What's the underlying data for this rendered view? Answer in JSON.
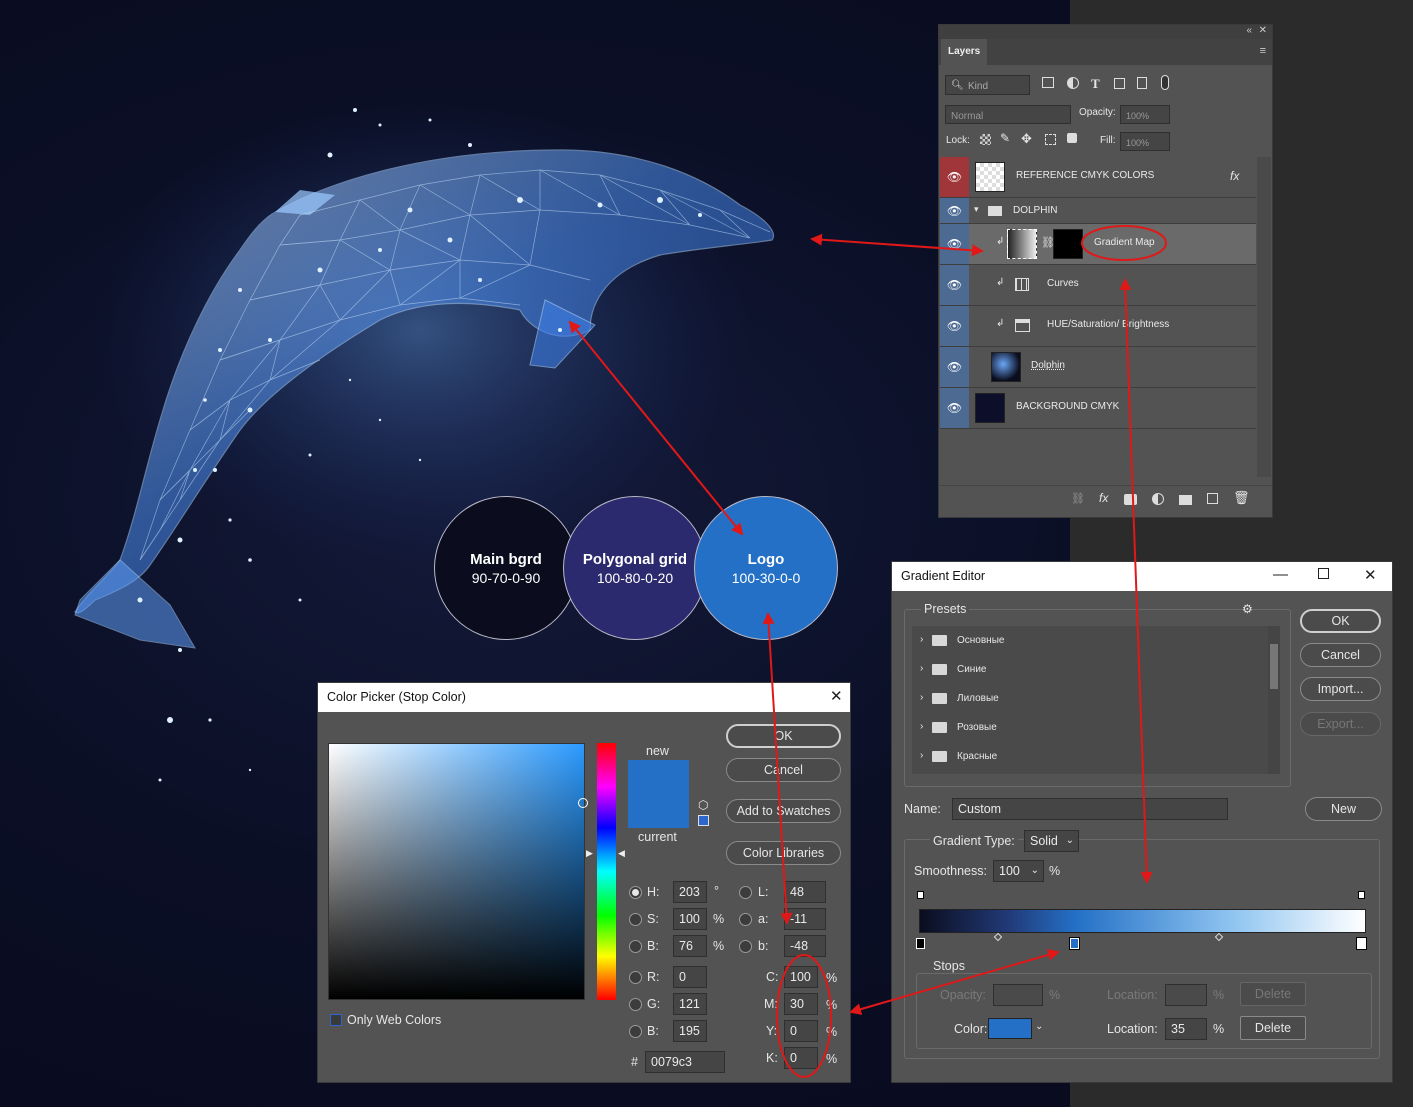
{
  "colors": {
    "arrow": "#e01818",
    "main_bgrd_fill": "#0b0d1e",
    "poly_grid_fill": "#2b2a6e",
    "logo_fill": "#2470c6",
    "eye_blue": "#4d6a92",
    "eye_red": "#a0363a"
  },
  "circles": [
    {
      "title": "Main bgrd",
      "value": "90-70-0-90"
    },
    {
      "title": "Polygonal grid",
      "value": "100-80-0-20"
    },
    {
      "title": "Logo",
      "value": "100-30-0-0"
    }
  ],
  "layers_panel": {
    "tab": "Layers",
    "filter_kind": "Kind",
    "blend_mode": "Normal",
    "opacity_label": "Opacity:",
    "opacity_value": "100%",
    "lock_label": "Lock:",
    "fill_label": "Fill:",
    "fill_value": "100%",
    "fx_label": "fx",
    "layers": [
      "REFERENCE CMYK COLORS",
      "DOLPHIN",
      "Gradient Map",
      "Curves",
      "HUE/Saturation/ Brightness",
      "Dolphin",
      "BACKGROUND CMYK"
    ]
  },
  "gradient_editor": {
    "title": "Gradient Editor",
    "presets_label": "Presets",
    "presets": [
      "Основные",
      "Синие",
      "Лиловые",
      "Розовые",
      "Красные"
    ],
    "ok": "OK",
    "cancel": "Cancel",
    "import": "Import...",
    "export": "Export...",
    "name_label": "Name:",
    "name_value": "Custom",
    "new": "New",
    "gradient_type_label": "Gradient Type:",
    "gradient_type_value": "Solid",
    "smoothness_label": "Smoothness:",
    "smoothness_value": "100",
    "percent": "%",
    "stops_label": "Stops",
    "opacity_label": "Opacity:",
    "location_label": "Location:",
    "delete": "Delete",
    "color_label": "Color:",
    "color_location_value": "35",
    "stop_color": "#2470c6"
  },
  "color_picker": {
    "title": "Color Picker (Stop Color)",
    "new_label": "new",
    "current_label": "current",
    "ok": "OK",
    "cancel": "Cancel",
    "add_to_swatches": "Add to Swatches",
    "color_libraries": "Color Libraries",
    "only_web_colors": "Only Web Colors",
    "hsb": {
      "H": "203",
      "S": "100",
      "B": "76"
    },
    "lab": {
      "L": "48",
      "a": "-11",
      "b": "-48"
    },
    "rgb": {
      "R": "0",
      "G": "121",
      "B": "195"
    },
    "cmyk": {
      "C": "100",
      "M": "30",
      "Y": "0",
      "K": "0"
    },
    "hex": "0079c3",
    "units": {
      "deg": "°",
      "pct": "%"
    },
    "labels": {
      "H": "H:",
      "S": "S:",
      "B": "B:",
      "L": "L:",
      "a": "a:",
      "b": "b:",
      "R": "R:",
      "G": "G:",
      "Bl": "B:",
      "C": "C:",
      "M": "M:",
      "Y": "Y:",
      "K": "K:",
      "hash": "#"
    },
    "new_color": "#2470c6",
    "current_color": "#2470c6"
  }
}
